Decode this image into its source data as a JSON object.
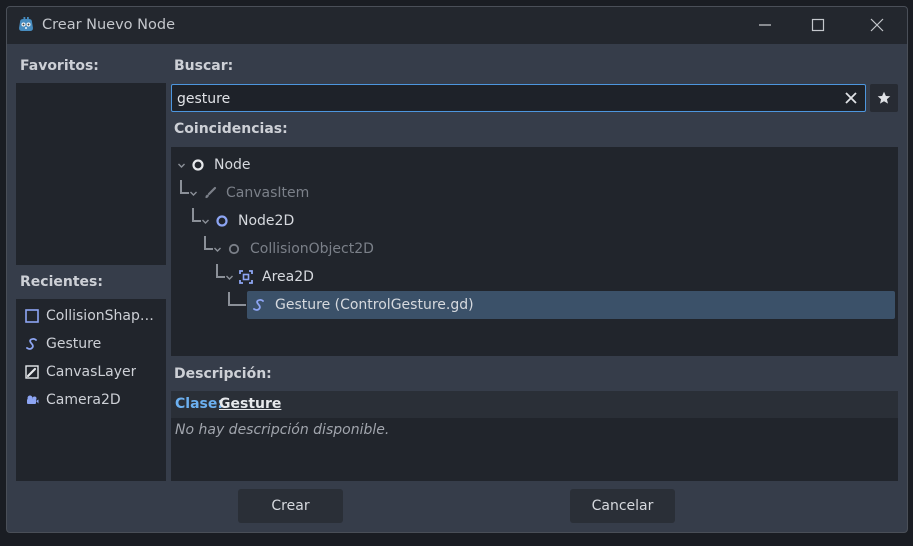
{
  "window": {
    "title": "Crear Nuevo Node"
  },
  "favorites": {
    "label": "Favoritos:"
  },
  "recents": {
    "label": "Recientes:",
    "items": [
      {
        "label": "CollisionShap…",
        "icon": "collision-shape-icon"
      },
      {
        "label": "Gesture",
        "icon": "gesture-script-icon"
      },
      {
        "label": "CanvasLayer",
        "icon": "canvas-layer-icon"
      },
      {
        "label": "Camera2D",
        "icon": "camera-icon"
      }
    ]
  },
  "search": {
    "label": "Buscar:",
    "value": "gesture"
  },
  "matches": {
    "label": "Coincidencias:",
    "tree": [
      {
        "label": "Node",
        "icon": "node-circle-icon",
        "depth": 0,
        "dim": false
      },
      {
        "label": "CanvasItem",
        "icon": "brush-icon",
        "depth": 1,
        "dim": true
      },
      {
        "label": "Node2D",
        "icon": "node2d-circle-icon",
        "depth": 2,
        "dim": false
      },
      {
        "label": "CollisionObject2D",
        "icon": "collision-object-icon",
        "depth": 3,
        "dim": true
      },
      {
        "label": "Area2D",
        "icon": "area2d-icon",
        "depth": 4,
        "dim": false
      },
      {
        "label": "Gesture (ControlGesture.gd)",
        "icon": "gesture-script-icon",
        "depth": 5,
        "dim": false,
        "selected": true
      }
    ]
  },
  "description": {
    "label": "Descripción:",
    "class_prefix": "Clase:",
    "class_name": "Gesture",
    "text": "No hay descripción disponible."
  },
  "buttons": {
    "create": "Crear",
    "cancel": "Cancelar"
  },
  "colors": {
    "accent": "#4d96de",
    "selection": "#3b5169",
    "node_blue": "#8da5f3"
  }
}
